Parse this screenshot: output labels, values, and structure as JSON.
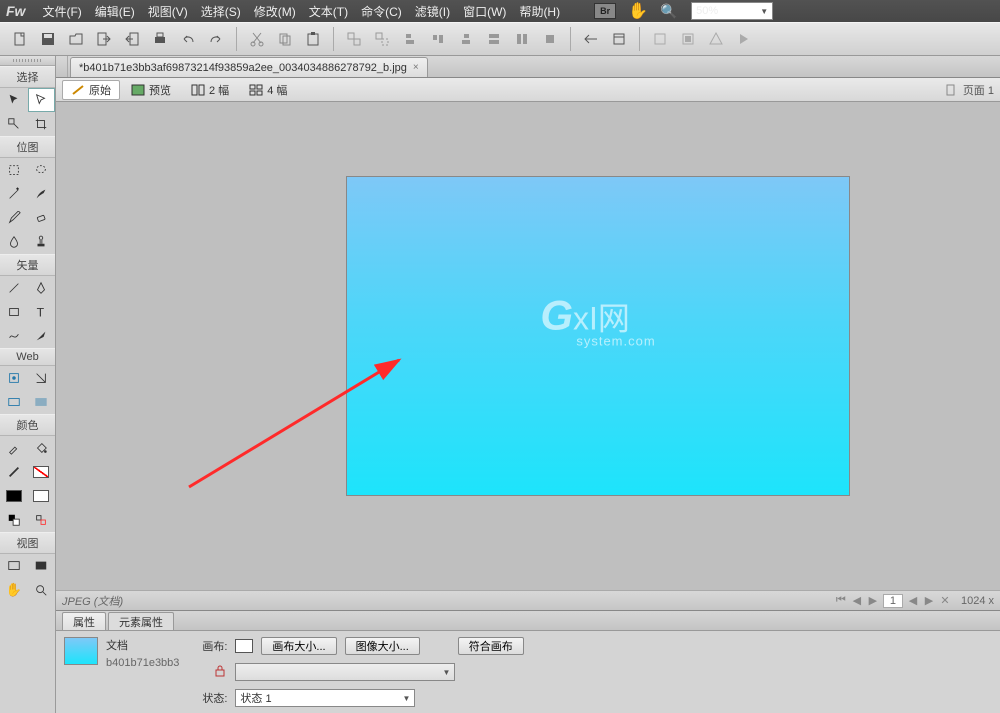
{
  "menubar": {
    "logo": "Fw",
    "items": [
      "文件(F)",
      "编辑(E)",
      "视图(V)",
      "选择(S)",
      "修改(M)",
      "文本(T)",
      "命令(C)",
      "滤镜(I)",
      "窗口(W)",
      "帮助(H)"
    ],
    "bridge_badge": "Br",
    "zoom": "50%"
  },
  "filetab": {
    "name": "*b401b71e3bb3af69873214f93859a2ee_0034034886278792_b.jpg",
    "close": "×"
  },
  "viewtabs": {
    "original": "原始",
    "preview": "预览",
    "two_up": "2 幅",
    "four_up": "4 幅",
    "page_label": "页面 1"
  },
  "watermark": {
    "big": "G",
    "rest": "xI网",
    "sub": "system.com"
  },
  "nav": {
    "jpeg": "JPEG (文档)",
    "page": "1",
    "dim": "1024 x"
  },
  "toolpanel": {
    "select": "选择",
    "bitmap": "位图",
    "vector": "矢量",
    "web": "Web",
    "color": "颜色",
    "view": "视图"
  },
  "props": {
    "tab_attr": "属性",
    "tab_elem": "元素属性",
    "doc_label": "文档",
    "filename": "b401b71e3bb3",
    "canvas_label": "画布:",
    "canvas_size": "画布大小...",
    "image_size": "图像大小...",
    "fit_canvas": "符合画布",
    "state_label": "状态:",
    "state_value": "状态 1"
  }
}
